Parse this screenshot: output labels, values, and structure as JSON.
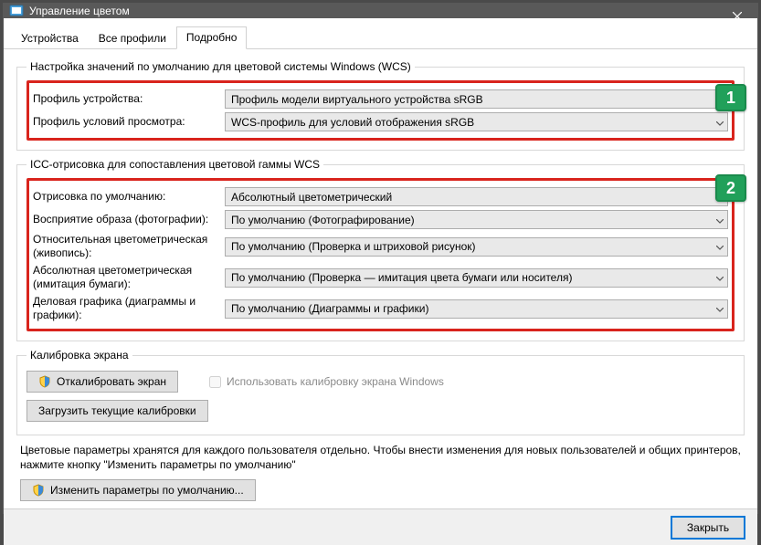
{
  "window": {
    "title": "Управление цветом",
    "close_tooltip": "Закрыть"
  },
  "tabs": {
    "devices": "Устройства",
    "all_profiles": "Все профили",
    "advanced": "Подробно"
  },
  "group_wcs": {
    "legend": "Настройка значений по умолчанию для цветовой системы Windows (WCS)",
    "device_profile_label": "Профиль устройства:",
    "device_profile_value": "Профиль модели виртуального устройства sRGB",
    "viewing_profile_label": "Профиль условий просмотра:",
    "viewing_profile_value": "WCS-профиль для условий отображения sRGB"
  },
  "group_icc": {
    "legend": "ICC-отрисовка для сопоставления цветовой гаммы WCS",
    "default_render_label": "Отрисовка по умолчанию:",
    "default_render_value": "Абсолютный цветометрический",
    "perceptual_label": "Восприятие образа (фотографии):",
    "perceptual_value": "По умолчанию (Фотографирование)",
    "relative_label": "Относительная цветометрическая (живопись):",
    "relative_value": "По умолчанию (Проверка и штриховой рисунок)",
    "absolute_label": "Абсолютная цветометрическая (имитация бумаги):",
    "absolute_value": "По умолчанию (Проверка — имитация цвета бумаги или носителя)",
    "business_label": "Деловая графика (диаграммы и графики):",
    "business_value": "По умолчанию (Диаграммы и графики)"
  },
  "group_calib": {
    "legend": "Калибровка экрана",
    "calibrate_btn": "Откалибровать экран",
    "use_calibration_checkbox": "Использовать калибровку экрана Windows",
    "load_calibrations_btn": "Загрузить текущие калибровки"
  },
  "note_text": "Цветовые параметры хранятся для каждого пользователя отдельно. Чтобы внести изменения для новых пользователей и общих принтеров, нажмите кнопку \"Изменить параметры по умолчанию\"",
  "change_defaults_btn": "Изменить параметры по умолчанию...",
  "footer": {
    "close": "Закрыть"
  },
  "badges": {
    "one": "1",
    "two": "2"
  }
}
